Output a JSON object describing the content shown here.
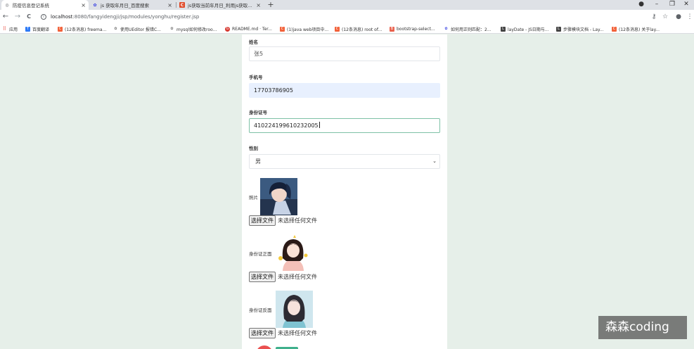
{
  "browser": {
    "tabs": [
      {
        "title": "防疫信息登记系统",
        "icon_color": "#5f6368",
        "icon_glyph": "◎",
        "active": true
      },
      {
        "title": "js 获取年月日_百度搜索",
        "icon_color": "#2932e1",
        "icon_glyph": "✿",
        "active": false
      },
      {
        "title": "js获取当前年月日_利用js获取当前年月日",
        "icon_color": "#e04b2b",
        "icon_glyph": "C",
        "active": false
      }
    ],
    "tab_close_glyph": "×",
    "new_tab_glyph": "+",
    "window_controls": {
      "account": "●",
      "minimize": "–",
      "restore": "❐",
      "close": "✕"
    },
    "nav": {
      "back": "←",
      "forward": "→",
      "reload": "C"
    },
    "address": {
      "host": "localhost",
      "path": ":8080/fangyidengji/jsp/modules/yonghu/register.jsp",
      "info_glyph": "i"
    },
    "toolbar_icons": {
      "key": "⚷",
      "star": "☆",
      "profile": "●",
      "menu": "⋮"
    },
    "bookmarks": [
      {
        "label": "应用",
        "icon_color": "#e94235",
        "glyph": "⠿"
      },
      {
        "label": "百度翻译",
        "icon_color": "#2f7bf6",
        "glyph": "T"
      },
      {
        "label": "(12条消息) freema...",
        "icon_color": "#f2623a",
        "glyph": "C"
      },
      {
        "label": "使用UEditor 报错C...",
        "icon_color": "#666666",
        "glyph": "✿"
      },
      {
        "label": "mysql如何修改roo...",
        "icon_color": "#666666",
        "glyph": "✿"
      },
      {
        "label": "README.md · Ter...",
        "icon_color": "#d73a32",
        "glyph": "G"
      },
      {
        "label": "(1)java web项目中...",
        "icon_color": "#f2623a",
        "glyph": "C"
      },
      {
        "label": "(12条消息) root of...",
        "icon_color": "#f2623a",
        "glyph": "C"
      },
      {
        "label": "bootstrap-select...",
        "icon_color": "#e9614d",
        "glyph": "B"
      },
      {
        "label": "如何用正则匹配：2...",
        "icon_color": "#2932e1",
        "glyph": "✿"
      },
      {
        "label": "layDate - JS日期与...",
        "icon_color": "#444444",
        "glyph": "L"
      },
      {
        "label": "步骤模块文档 - Lay...",
        "icon_color": "#444444",
        "glyph": "L"
      },
      {
        "label": "(12条消息) 关于lay...",
        "icon_color": "#f2623a",
        "glyph": "C"
      }
    ]
  },
  "form": {
    "name": {
      "label": "姓名",
      "value": "张5"
    },
    "phone": {
      "label": "手机号",
      "value": "17703786905"
    },
    "id_number": {
      "label": "身份证号",
      "value": "410224199610232005"
    },
    "gender": {
      "label": "性别",
      "value": "男",
      "chevron": "⌄"
    },
    "photo": {
      "label": "照片",
      "button": "选择文件",
      "status": "未选择任何文件"
    },
    "id_front": {
      "label": "身份证正面",
      "button": "选择文件",
      "status": "未选择任何文件"
    },
    "id_back": {
      "label": "身份证反面",
      "button": "选择文件",
      "status": "未选择任何文件"
    }
  },
  "colors": {
    "page_bg": "#e6efe9",
    "autofill_bg": "#e8f0fe",
    "focus_border": "#7ec1a6",
    "submit_red": "#ea5050",
    "reset_green": "#3fb08c"
  },
  "watermark": {
    "text": "森森coding"
  }
}
